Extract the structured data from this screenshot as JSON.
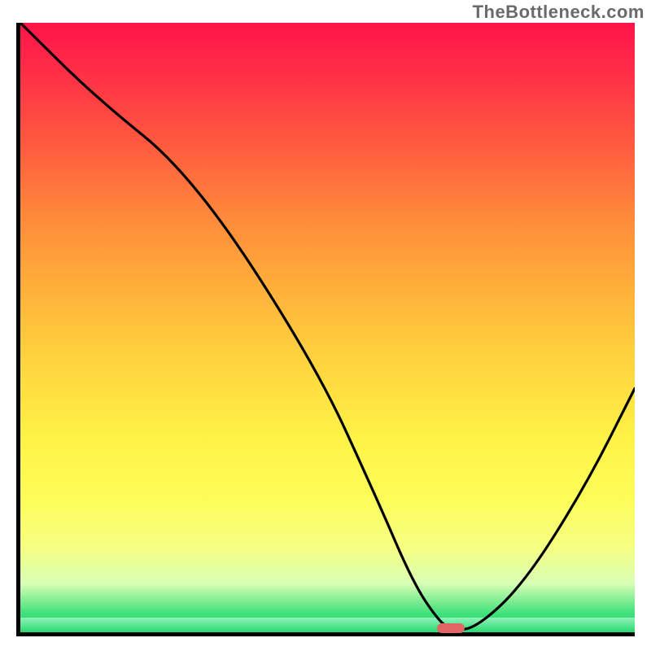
{
  "watermark": "TheBottleneck.com",
  "chart_data": {
    "type": "line",
    "title": "",
    "xlabel": "",
    "ylabel": "",
    "xlim": [
      0,
      100
    ],
    "ylim": [
      0,
      100
    ],
    "grid": false,
    "legend": false,
    "series": [
      {
        "name": "bottleneck-curve",
        "x": [
          0,
          12,
          28,
          48,
          58,
          64,
          68,
          70,
          74,
          82,
          92,
          100
        ],
        "values": [
          100,
          88,
          75,
          44,
          22,
          8,
          2,
          0.5,
          0.5,
          8,
          24,
          40
        ]
      }
    ],
    "marker": {
      "x": 70,
      "y": 0.7,
      "color": "#e06666"
    },
    "background": {
      "type": "vertical-gradient",
      "stops": [
        {
          "pct": 0,
          "color": "#ff1449"
        },
        {
          "pct": 8,
          "color": "#ff2e47"
        },
        {
          "pct": 20,
          "color": "#ff5a3f"
        },
        {
          "pct": 32,
          "color": "#ff8a3a"
        },
        {
          "pct": 44,
          "color": "#ffb13a"
        },
        {
          "pct": 56,
          "color": "#ffd53e"
        },
        {
          "pct": 68,
          "color": "#fff246"
        },
        {
          "pct": 78,
          "color": "#fdfd58"
        },
        {
          "pct": 86,
          "color": "#f6ff82"
        },
        {
          "pct": 92,
          "color": "#d8ffb5"
        },
        {
          "pct": 97,
          "color": "#3ee07a"
        },
        {
          "pct": 100,
          "color": "#27d96f"
        }
      ]
    }
  }
}
